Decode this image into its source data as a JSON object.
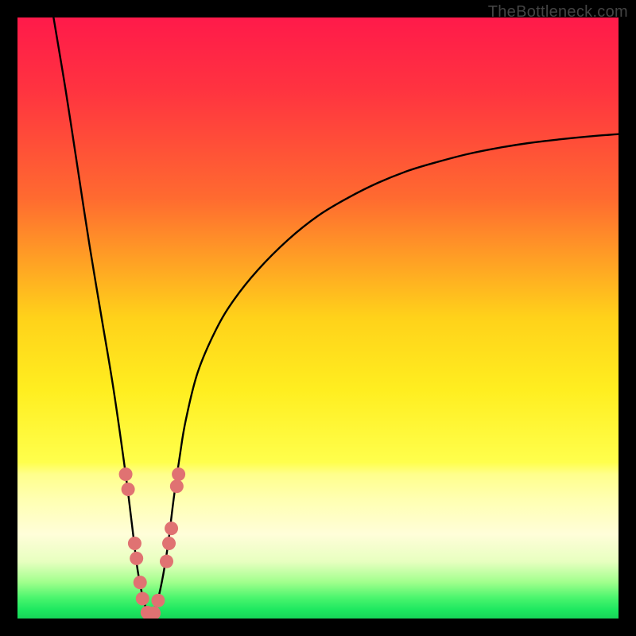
{
  "watermark": {
    "text": "TheBottleneck.com"
  },
  "colors": {
    "frame": "#000000",
    "curve_stroke": "#000000",
    "marker_fill": "#e07272",
    "marker_stroke": "#e05858",
    "gradient_stops": [
      {
        "offset": 0.0,
        "color": "#ff1a4a"
      },
      {
        "offset": 0.12,
        "color": "#ff3340"
      },
      {
        "offset": 0.3,
        "color": "#ff6a30"
      },
      {
        "offset": 0.5,
        "color": "#ffd21a"
      },
      {
        "offset": 0.62,
        "color": "#ffee20"
      },
      {
        "offset": 0.74,
        "color": "#ffff4c"
      },
      {
        "offset": 0.76,
        "color": "#ffff8c"
      },
      {
        "offset": 0.8,
        "color": "#ffffb0"
      },
      {
        "offset": 0.86,
        "color": "#fffed9"
      },
      {
        "offset": 0.905,
        "color": "#e8ffc0"
      },
      {
        "offset": 0.94,
        "color": "#a0ff8c"
      },
      {
        "offset": 0.965,
        "color": "#4cf56e"
      },
      {
        "offset": 0.985,
        "color": "#1ee860"
      },
      {
        "offset": 1.0,
        "color": "#17d558"
      }
    ]
  },
  "chart_data": {
    "type": "line",
    "title": "",
    "xlabel": "",
    "ylabel": "",
    "xlim": [
      0,
      100
    ],
    "ylim": [
      0,
      100
    ],
    "series": [
      {
        "name": "bottleneck-curve",
        "note": "V-shaped curve; y approaches 0 at minimum near x≈22; rises steeply on both sides. Left branch reaches y≈100 at x≈6; right branch rises asymptotically toward y≈80 at x=100.",
        "x": [
          6,
          8,
          10,
          12,
          14,
          16,
          18,
          19,
          20,
          21,
          22,
          23,
          24,
          25,
          26,
          27,
          28,
          30,
          33,
          36,
          40,
          45,
          50,
          55,
          60,
          65,
          70,
          75,
          80,
          85,
          90,
          95,
          100
        ],
        "values": [
          100,
          88,
          75,
          62,
          50,
          38,
          24,
          16,
          8,
          3,
          0.5,
          2,
          6,
          12,
          20,
          27,
          33,
          41,
          48,
          53,
          58,
          63,
          67,
          70,
          72.5,
          74.5,
          76,
          77.3,
          78.3,
          79.1,
          79.7,
          80.2,
          80.6
        ]
      }
    ],
    "markers": {
      "name": "highlight-points",
      "note": "Salmon circular markers clustered near the valley along both branches and at the bottom.",
      "points": [
        {
          "x": 18.0,
          "y": 24.0
        },
        {
          "x": 18.4,
          "y": 21.5
        },
        {
          "x": 19.5,
          "y": 12.5
        },
        {
          "x": 19.8,
          "y": 10.0
        },
        {
          "x": 20.4,
          "y": 6.0
        },
        {
          "x": 20.8,
          "y": 3.3
        },
        {
          "x": 21.6,
          "y": 1.0
        },
        {
          "x": 22.0,
          "y": 0.5
        },
        {
          "x": 22.7,
          "y": 0.9
        },
        {
          "x": 23.4,
          "y": 3.0
        },
        {
          "x": 24.8,
          "y": 9.5
        },
        {
          "x": 25.2,
          "y": 12.5
        },
        {
          "x": 25.6,
          "y": 15.0
        },
        {
          "x": 26.5,
          "y": 22.0
        },
        {
          "x": 26.8,
          "y": 24.0
        }
      ]
    }
  }
}
